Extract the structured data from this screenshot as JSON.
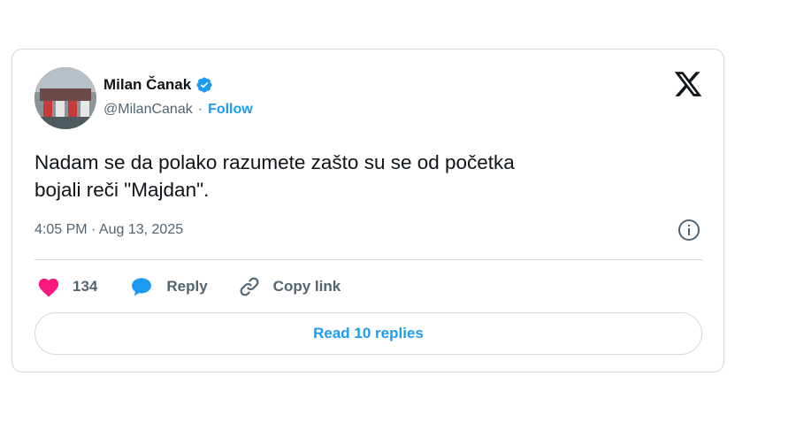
{
  "tweet": {
    "author_name": "Milan Čanak",
    "handle": "@MilanCanak",
    "separator": "·",
    "follow_label": "Follow",
    "text": "Nadam se da polako razumete zašto su se od početka\nbojali reči \"Majdan\".",
    "timestamp": "4:05 PM · Aug 13, 2025",
    "verified": true
  },
  "actions": {
    "like_count": "134",
    "reply_label": "Reply",
    "copy_link_label": "Copy link"
  },
  "read_replies_label": "Read 10 replies",
  "colors": {
    "accent": "#1d9bf0",
    "like": "#f91880",
    "text": "#0f1419",
    "muted": "#536471",
    "border": "#cfd9de"
  },
  "icons": [
    "verified-badge-icon",
    "x-logo-icon",
    "info-icon",
    "heart-icon",
    "speech-bubble-icon",
    "link-icon"
  ]
}
